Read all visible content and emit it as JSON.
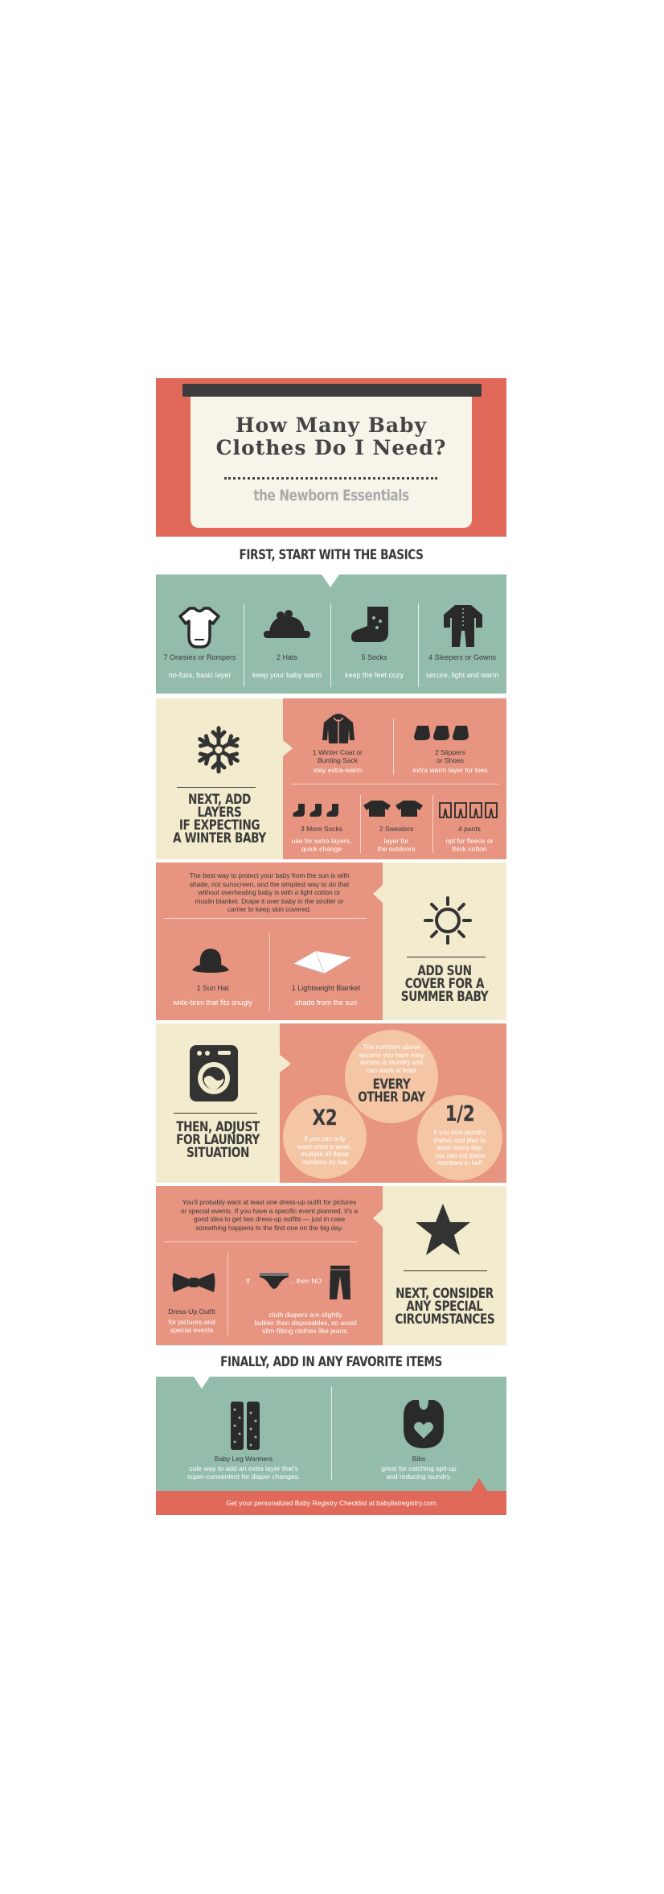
{
  "header": {
    "title_line1": "How Many Baby",
    "title_line2": "Clothes Do I Need?",
    "subtitle": "the Newborn Essentials"
  },
  "basics": {
    "heading": "FIRST, START WITH THE BASICS",
    "items": [
      {
        "icon": "onesie-icon",
        "title": "7 Onesies or Rompers",
        "sub": "no-fuss, basic layer"
      },
      {
        "icon": "hat-icon",
        "title": "2 Hats",
        "sub": "keep your baby warm"
      },
      {
        "icon": "sock-icon",
        "title": "5 Socks",
        "sub": "keep the feet cozy"
      },
      {
        "icon": "sleeper-icon",
        "title": "4 Sleepers or Gowns",
        "sub": "secure, light and warm"
      }
    ]
  },
  "winter": {
    "heading_l1": "NEXT, ADD LAYERS",
    "heading_l2": "IF EXPECTING",
    "heading_l3": "A WINTER BABY",
    "items": [
      {
        "icon": "coat-icon",
        "title_l1": "1 Winter Coat or",
        "title_l2": "Bunting Sack",
        "sub_l1": "stay extra-warm",
        "sub_l2": ""
      },
      {
        "icon": "slippers-icon",
        "title_l1": "2 Slippers",
        "title_l2": "or Shoes",
        "sub_l1": "extra warm layer for toes",
        "sub_l2": ""
      },
      {
        "icon": "socks-icon",
        "title_l1": "3 More Socks",
        "title_l2": "",
        "sub_l1": "use for extra layers,",
        "sub_l2": "quick change"
      },
      {
        "icon": "sweater-icon",
        "title_l1": "2 Sweaters",
        "title_l2": "",
        "sub_l1": "layer for",
        "sub_l2": "the outdoors"
      },
      {
        "icon": "pants-icon",
        "title_l1": "4 pants",
        "title_l2": "",
        "sub_l1": "opt for fleece or",
        "sub_l2": "thick cotton"
      }
    ]
  },
  "summer": {
    "paragraph_l1": "The best way to protect your baby from the sun is with",
    "paragraph_l2": "shade, not sunscreen, and the simplest way to do that",
    "paragraph_l3": "without overheating baby is with a light cotton or",
    "paragraph_l4": "muslin blanket. Drape it over baby in the stroller or",
    "paragraph_l5": "carrier to keep skin covered.",
    "heading_l1": "ADD SUN",
    "heading_l2": "COVER FOR A",
    "heading_l3": "SUMMER BABY",
    "items": [
      {
        "icon": "sun-hat-icon",
        "title": "1 Sun Hat",
        "sub": "wide-brim that fits snugly"
      },
      {
        "icon": "blanket-icon",
        "title": "1 Lightweight Blanket",
        "sub": "shade from the sun"
      }
    ]
  },
  "laundry": {
    "heading_l1": "THEN, ADJUST",
    "heading_l2": "FOR LAUNDRY",
    "heading_l3": "SITUATION",
    "center_l1": "The numbers above",
    "center_l2": "assume you have easy",
    "center_l3": "access to laundry and",
    "center_l4": "can wash at least",
    "center_big_l1": "EVERY",
    "center_big_l2": "OTHER DAY",
    "left_big": "X2",
    "left_l1": "If you can only",
    "left_l2": "wash once a week,",
    "left_l3": "multiple all these",
    "left_l4": "numbers by two",
    "right_big": "1/2",
    "right_l1": "If you love laundry",
    "right_l2": "(haha) and plan to",
    "right_l3": "wash every day,",
    "right_l4": "you can cut these",
    "right_l5": "numbers in half"
  },
  "special": {
    "paragraph_l1": "You'll probably want at least one dress-up outfit for pictures",
    "paragraph_l2": "or special events. If you have a specific event planned, it's a",
    "paragraph_l3": "good idea to get two dress-up outfits — just in case",
    "paragraph_l4": "something happens to the first one on the big day.",
    "heading_l1": "NEXT, CONSIDER",
    "heading_l2": "ANY SPECIAL",
    "heading_l3": "CIRCUMSTANCES",
    "item1_title": "Dress-Up Outfit",
    "item1_sub_l1": "for pictures and",
    "item1_sub_l2": "special events",
    "if_label": "If",
    "then_label": "... then NO",
    "item2_sub_l1": "cloth diapers are slightly",
    "item2_sub_l2": "bulkier than disposables, so avoid",
    "item2_sub_l3": "slim-fitting clothes like jeans."
  },
  "favorites": {
    "heading": "FINALLY, ADD IN ANY FAVORITE ITEMS",
    "items": [
      {
        "icon": "leg-warmers-icon",
        "title": "Baby Leg Warmers",
        "sub_l1": "cute way to add an extra layer that's",
        "sub_l2": "super-convenient for diaper changes."
      },
      {
        "icon": "bib-icon",
        "title": "Bibs",
        "sub_l1": "great for catching spit-up",
        "sub_l2": "and reducing laundry."
      }
    ]
  },
  "footer": {
    "text": "Get your personalized Baby Registry Checklist at babylistregistry.com"
  },
  "colors": {
    "coral": "#e0695a",
    "teal": "#93bcab",
    "salmon": "#e79480",
    "cream": "#f2ebcd",
    "dark": "#383838",
    "peach": "#f4c6a5"
  }
}
